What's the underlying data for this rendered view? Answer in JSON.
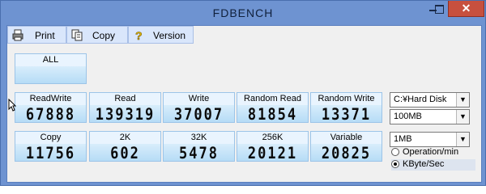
{
  "window": {
    "title": "FDBENCH"
  },
  "toolbar": {
    "print": "Print",
    "copy": "Copy",
    "version": "Version"
  },
  "row0": {
    "all": "ALL"
  },
  "row1": [
    {
      "label": "ReadWrite",
      "value": "67888"
    },
    {
      "label": "Read",
      "value": "139319"
    },
    {
      "label": "Write",
      "value": "37007"
    },
    {
      "label": "Random Read",
      "value": "81854"
    },
    {
      "label": "Random Write",
      "value": "13371"
    }
  ],
  "row2": [
    {
      "label": "Copy",
      "value": "11756"
    },
    {
      "label": "2K",
      "value": "602"
    },
    {
      "label": "32K",
      "value": "5478"
    },
    {
      "label": "256K",
      "value": "20121"
    },
    {
      "label": "Variable",
      "value": "20825"
    }
  ],
  "options": {
    "drive": "C:¥Hard Disk",
    "size": "100MB",
    "block": "1MB",
    "unit_ops": "Operation/min",
    "unit_kb": "KByte/Sec",
    "selected_unit": "KByte/Sec"
  }
}
